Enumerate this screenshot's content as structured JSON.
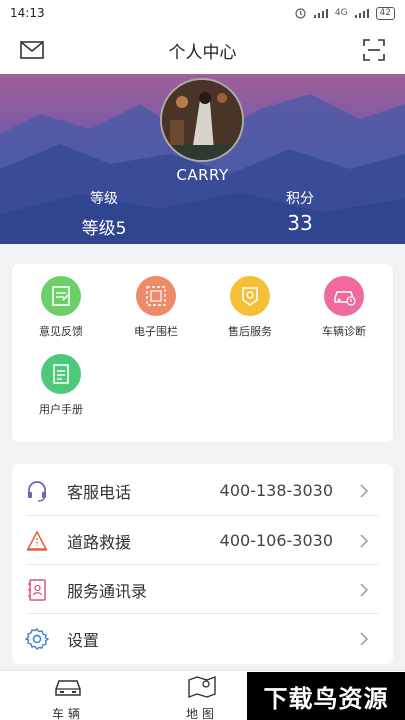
{
  "status_bar": {
    "time": "14:13",
    "network": "4G",
    "battery": "42"
  },
  "header": {
    "title": "个人中心",
    "left_icon": "mail-icon",
    "right_icon": "scan-icon"
  },
  "profile": {
    "username": "CARRY",
    "level_label": "等级",
    "level_value": "等级5",
    "points_label": "积分",
    "points_value": "33"
  },
  "grid": [
    {
      "label": "意见反馈",
      "icon": "feedback-icon",
      "color": "#6ccf68"
    },
    {
      "label": "电子围栏",
      "icon": "fence-icon",
      "color": "#ee8a6a"
    },
    {
      "label": "售后服务",
      "icon": "service-icon",
      "color": "#f5c038"
    },
    {
      "label": "车辆诊断",
      "icon": "car-diagnose-icon",
      "color": "#ee6aa0"
    },
    {
      "label": "用户手册",
      "icon": "manual-icon",
      "color": "#4ec87a"
    }
  ],
  "list": [
    {
      "label": "客服电话",
      "value": "400-138-3030",
      "icon": "headset-icon",
      "color": "#7060c0"
    },
    {
      "label": "道路救援",
      "value": "400-106-3030",
      "icon": "road-rescue-icon",
      "color": "#e06040"
    },
    {
      "label": "服务通讯录",
      "value": "",
      "icon": "contacts-icon",
      "color": "#e0507a"
    },
    {
      "label": "设置",
      "value": "",
      "icon": "gear-icon",
      "color": "#3a7ed8"
    }
  ],
  "bottom_nav": [
    {
      "label": "车辆",
      "icon": "car-icon"
    },
    {
      "label": "地图",
      "icon": "map-icon"
    }
  ],
  "watermark": "下载鸟资源"
}
